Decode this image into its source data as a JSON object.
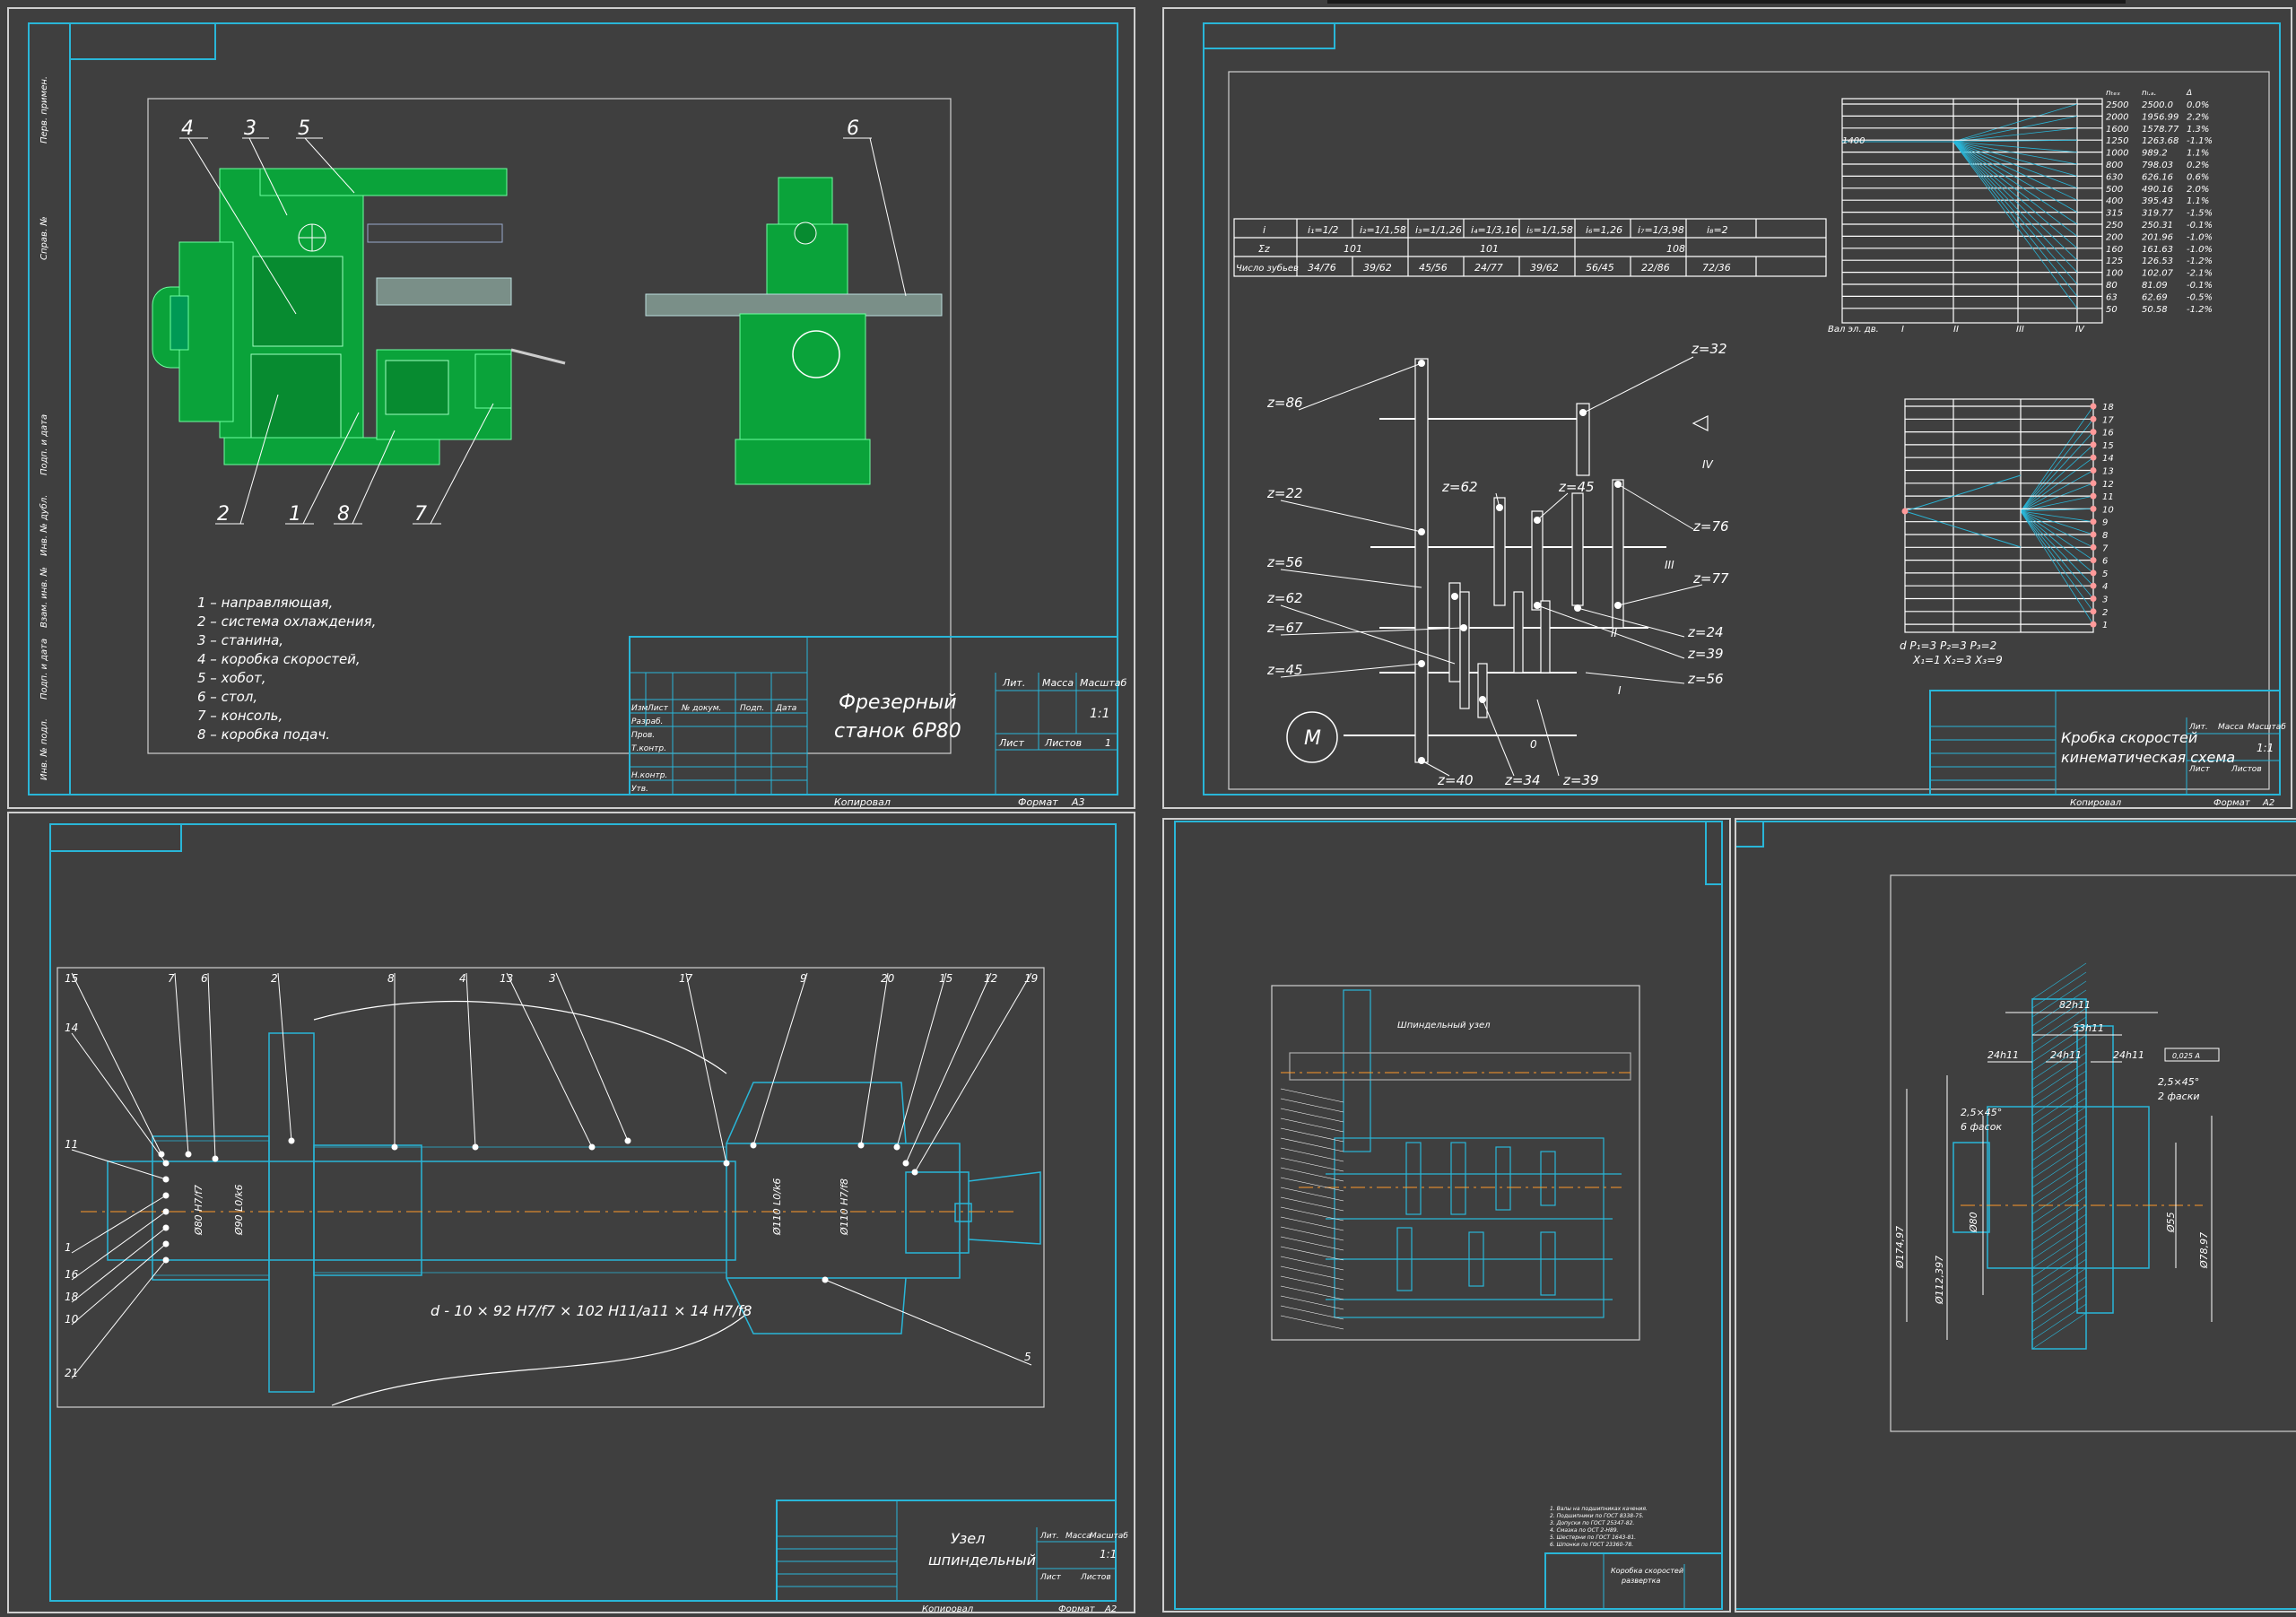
{
  "colors": {
    "background": "#3f3f3f",
    "frame": "#29b6d8",
    "machine": "#0aa33a",
    "text": "#ffffff",
    "point": "#ffd7d7"
  },
  "sheet1": {
    "callouts": [
      "4",
      "3",
      "5",
      "6",
      "2",
      "1",
      "8",
      "7"
    ],
    "legend": [
      "1 – направляющая,",
      "2 – система охлаждения,",
      "3 – станина,",
      "4 – коробка скоростей,",
      "5 – хобот,",
      "6 – стол,",
      "7 – консоль,",
      "8 – коробка подач."
    ],
    "title_line1": "Фрезерный",
    "title_line2": "станок 6Р80",
    "tb_headers": [
      "Лит.",
      "Масса",
      "Масштаб"
    ],
    "tb_scale": "1:1",
    "tb_sheet": "Лист",
    "tb_sheets": "Листов",
    "tb_sheets_val": "1",
    "tb_rows": [
      "Изм",
      "Лист",
      "№ докум.",
      "Подп.",
      "Дата"
    ],
    "tb_roles": [
      "Разраб.",
      "Пров.",
      "Т.контр.",
      "Н.контр.",
      "Утв."
    ],
    "copied": "Копировал",
    "format": "Формат",
    "format_val": "A3",
    "side_labels": [
      "Перв. примен.",
      "Справ. №",
      "Подп. и дата",
      "Инв. № дубл.",
      "Взам. инв. №",
      "Подп. и дата",
      "Инв. № подл."
    ]
  },
  "sheet2": {
    "table_header": [
      "i",
      "i₁=1/2",
      "i₂=1/1,58",
      "i₃=1/1,26",
      "i₄=1/3,16",
      "i₅=1/1,58",
      "i₆=1,26",
      "i₇=1/3,98",
      "i₈=2"
    ],
    "table_sum_label": "Σz",
    "table_sum": [
      "101",
      "101",
      "108"
    ],
    "table_teeth_label": "Число зубьев",
    "table_teeth": [
      "34/76",
      "39/62",
      "45/56",
      "24/77",
      "39/62",
      "56/45",
      "22/86",
      "72/36"
    ],
    "speed_table_headers": [
      "nₜₑₓ",
      "nₗ.ₐ.",
      "Δ"
    ],
    "speed_table": [
      [
        "2500",
        "2500.0",
        "0.0%"
      ],
      [
        "2000",
        "1956.99",
        "2.2%"
      ],
      [
        "1600",
        "1578.77",
        "1.3%"
      ],
      [
        "1250",
        "1263.68",
        "-1.1%"
      ],
      [
        "1000",
        "989.2",
        "1.1%"
      ],
      [
        "800",
        "798.03",
        "0.2%"
      ],
      [
        "630",
        "626.16",
        "0.6%"
      ],
      [
        "500",
        "490.16",
        "2.0%"
      ],
      [
        "400",
        "395.43",
        "1.1%"
      ],
      [
        "315",
        "319.77",
        "-1.5%"
      ],
      [
        "250",
        "250.31",
        "-0.1%"
      ],
      [
        "200",
        "201.96",
        "-1.0%"
      ],
      [
        "160",
        "161.63",
        "-1.0%"
      ],
      [
        "125",
        "126.53",
        "-1.2%"
      ],
      [
        "100",
        "102.07",
        "-2.1%"
      ],
      [
        "80",
        "81.09",
        "-0.1%"
      ],
      [
        "63",
        "62.69",
        "-0.5%"
      ],
      [
        "50",
        "50.58",
        "-1.2%"
      ]
    ],
    "graph_label_n": "1400",
    "graph_shaft_label": "Вал эл. дв.",
    "graph_shafts": [
      "I",
      "II",
      "III",
      "IV"
    ],
    "gears": [
      "z=86",
      "z=32",
      "z=22",
      "z=62",
      "z=45",
      "z=76",
      "z=56",
      "z=77",
      "z=62",
      "z=67",
      "z=24",
      "z=39",
      "z=45",
      "z=56",
      "z=40",
      "z=34",
      "z=39"
    ],
    "shaft_labels": [
      "IV",
      "III",
      "II",
      "I",
      "0"
    ],
    "motor": "M",
    "structure_numbers": [
      "18",
      "17",
      "16",
      "15",
      "14",
      "13",
      "12",
      "11",
      "10",
      "9",
      "8",
      "7",
      "6",
      "5",
      "4",
      "3",
      "2",
      "1"
    ],
    "formula_line1": "d P₁=3 P₂=3 P₃=2",
    "formula_line2": "X₁=1 X₂=3 X₃=9",
    "title_line1": "Кробка скоростей",
    "title_line2": "кинематическая схема",
    "tb_headers": [
      "Лит.",
      "Масса",
      "Масштаб"
    ],
    "tb_scale": "1:1",
    "tb_sheet": "Лист",
    "tb_sheets": "Листов",
    "copied": "Копировал",
    "format": "Формат",
    "format_val": "A2"
  },
  "sheet3": {
    "callouts_top": [
      "15",
      "7",
      "6",
      "2",
      "8",
      "4",
      "13",
      "3",
      "17",
      "9",
      "20",
      "15",
      "12",
      "19"
    ],
    "callouts_left": [
      "14",
      "11",
      "1",
      "16",
      "18",
      "10",
      "21"
    ],
    "callout_right": "5",
    "fit_formula": "d - 10 × 92 H7/f7 × 102 H11/a11 × 14 H7/f8",
    "dims": [
      "Ø80 H7/f7",
      "Ø90 L0/k6",
      "Ø110 L0/k6",
      "Ø110 H7/f8"
    ],
    "title_line1": "Узел",
    "title_line2": "шпиндельный",
    "tb_headers": [
      "Лит.",
      "Масса",
      "Масштаб"
    ],
    "tb_scale": "1:1",
    "tb_sheet": "Лист",
    "tb_sheets": "Листов",
    "copied": "Копировал",
    "format": "Формат",
    "format_val": "A2"
  },
  "sheet4": {
    "label": "Шпиндельный узел",
    "title_line1": "Коробка скоростей",
    "title_line2": "развертка",
    "notes": [
      "1. Валы на подшипниках качения.",
      "2. Подшипники по ГОСТ 8338-75.",
      "3. Допуски по ГОСТ 25347-82.",
      "4. Смазка по ОСТ 2-Н89.",
      "5. Шестерни по ГОСТ 1643-81.",
      "6. Шпонки по ГОСТ 23360-78."
    ]
  },
  "sheet5": {
    "dims": [
      "82h11",
      "53h11",
      "24h11",
      "24h11",
      "24h11",
      "2,5×45°",
      "6 фасок",
      "2,5×45°",
      "2 фаски",
      "Ø80",
      "Ø55",
      "Ø174,97",
      "Ø112,397",
      "Ø78,97"
    ],
    "tolerance": "0,025 А"
  }
}
